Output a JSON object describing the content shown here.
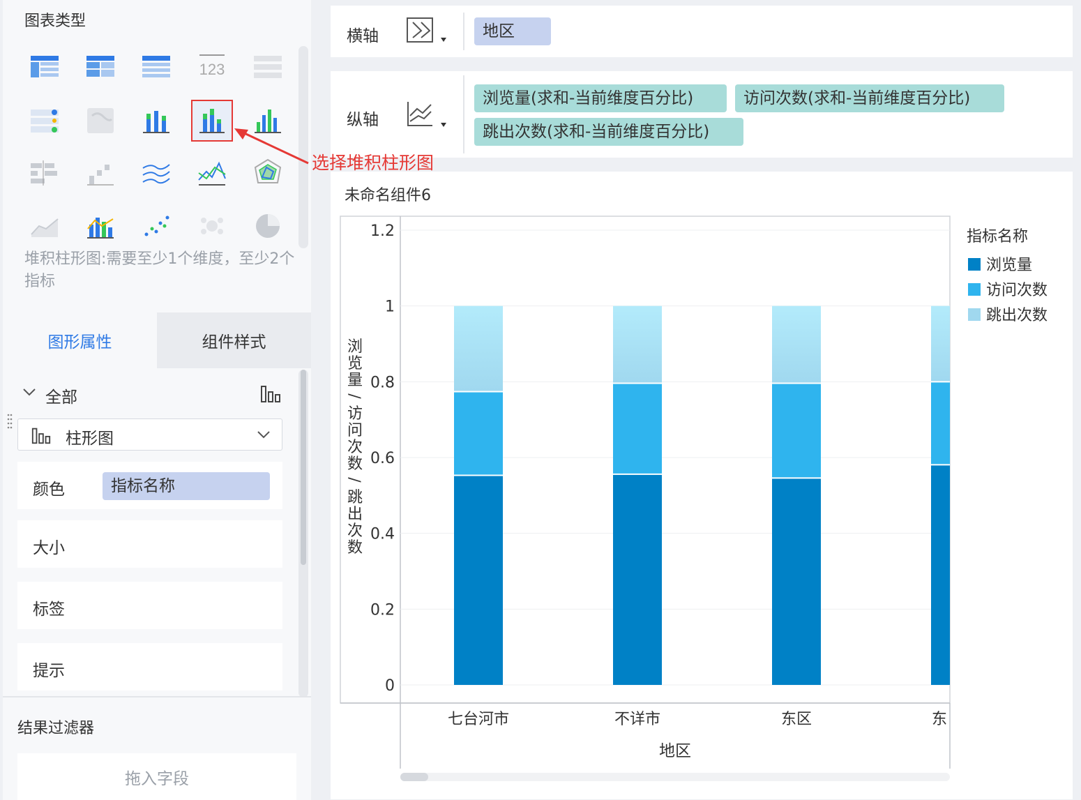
{
  "left_panel": {
    "chart_types_title": "图表类型",
    "hint": "堆积柱形图:需要至少1个维度，至少2个指标",
    "tabs": [
      {
        "label": "图形属性"
      },
      {
        "label": "组件样式"
      }
    ],
    "all_label": "全部",
    "chart_select_value": "柱形图",
    "props": {
      "color_label": "颜色",
      "color_field": "指标名称",
      "size_label": "大小",
      "tag_label": "标签",
      "tip_label": "提示"
    },
    "filter_title": "结果过滤器",
    "filter_drop": "拖入字段"
  },
  "axes": {
    "x_label": "横轴",
    "x_fields": [
      "地区"
    ],
    "y_label": "纵轴",
    "y_fields": [
      "浏览量(求和-当前维度百分比)",
      "访问次数(求和-当前维度百分比)",
      "跳出次数(求和-当前维度百分比)"
    ]
  },
  "annotation": "选择堆积柱形图",
  "widget_title": "未命名组件6",
  "colors": {
    "s1": "#0081c6",
    "s2": "#2fb4ee",
    "s3_top": "#b3ebfb",
    "s3_bottom": "#a0d8ef",
    "accent": "#2f7ae5",
    "annotation": "#e53935"
  },
  "chart_data": {
    "type": "bar",
    "stacked": true,
    "categories": [
      "七台河市",
      "不详市",
      "东区",
      "东"
    ],
    "series": [
      {
        "name": "浏览量",
        "values": [
          0.553,
          0.556,
          0.546,
          0.581
        ]
      },
      {
        "name": "访问次数",
        "values": [
          0.221,
          0.24,
          0.25,
          0.219
        ]
      },
      {
        "name": "跳出次数",
        "values": [
          0.226,
          0.204,
          0.204,
          0.2
        ]
      }
    ],
    "xlabel": "地区",
    "ylabel": "浏览量/访问次数/跳出次数",
    "ylim": [
      0,
      1.2
    ],
    "yticks": [
      "0",
      "0.2",
      "0.4",
      "0.6",
      "0.8",
      "1",
      "1.2"
    ],
    "legend_title": "指标名称",
    "legend_position": "right",
    "grid": true
  }
}
